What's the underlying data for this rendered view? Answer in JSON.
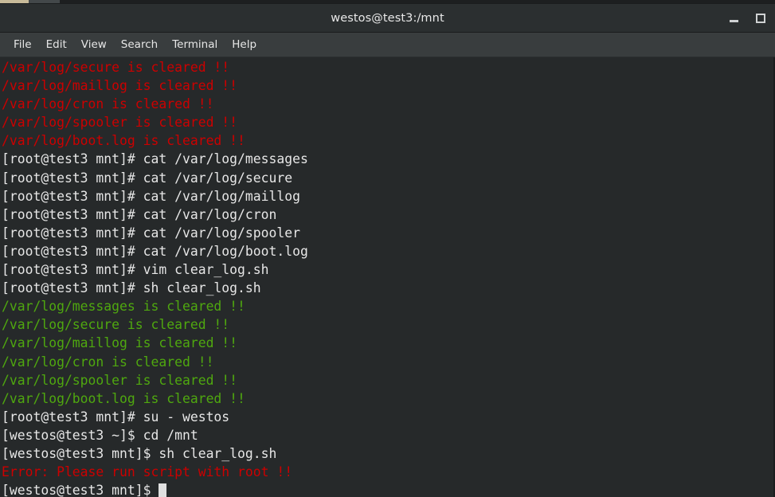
{
  "window": {
    "title": "westos@test3:/mnt",
    "controls": [
      {
        "name": "minimize",
        "label": "–"
      },
      {
        "name": "maximize",
        "label": "□"
      }
    ]
  },
  "menu": {
    "items": [
      {
        "label": "File"
      },
      {
        "label": "Edit"
      },
      {
        "label": "View"
      },
      {
        "label": "Search"
      },
      {
        "label": "Terminal"
      },
      {
        "label": "Help"
      }
    ]
  },
  "colors": {
    "titlebar_bg": "#2b2f30",
    "menubar_bg": "#393d3e",
    "terminal_bg": "#26292a",
    "text_white": "#e3e3e3",
    "text_red": "#cc0000",
    "text_green": "#4fa80f",
    "cursor": "#e0e0e0"
  },
  "terminal": {
    "prompt_root": "[root@test3 mnt]# ",
    "prompt_user_home": "[westos@test3 ~]$ ",
    "prompt_user_mnt": "[westos@test3 mnt]$ ",
    "lines": [
      {
        "color": "red",
        "text": "/var/log/secure is cleared !!"
      },
      {
        "color": "red",
        "text": "/var/log/maillog is cleared !!"
      },
      {
        "color": "red",
        "text": "/var/log/cron is cleared !!"
      },
      {
        "color": "red",
        "text": "/var/log/spooler is cleared !!"
      },
      {
        "color": "red",
        "text": "/var/log/boot.log is cleared !!"
      },
      {
        "color": "white",
        "text": "[root@test3 mnt]# cat /var/log/messages"
      },
      {
        "color": "white",
        "text": "[root@test3 mnt]# cat /var/log/secure"
      },
      {
        "color": "white",
        "text": "[root@test3 mnt]# cat /var/log/maillog"
      },
      {
        "color": "white",
        "text": "[root@test3 mnt]# cat /var/log/cron"
      },
      {
        "color": "white",
        "text": "[root@test3 mnt]# cat /var/log/spooler"
      },
      {
        "color": "white",
        "text": "[root@test3 mnt]# cat /var/log/boot.log"
      },
      {
        "color": "white",
        "text": "[root@test3 mnt]# vim clear_log.sh"
      },
      {
        "color": "white",
        "text": "[root@test3 mnt]# sh clear_log.sh"
      },
      {
        "color": "green",
        "text": "/var/log/messages is cleared !!"
      },
      {
        "color": "green",
        "text": "/var/log/secure is cleared !!"
      },
      {
        "color": "green",
        "text": "/var/log/maillog is cleared !!"
      },
      {
        "color": "green",
        "text": "/var/log/cron is cleared !!"
      },
      {
        "color": "green",
        "text": "/var/log/spooler is cleared !!"
      },
      {
        "color": "green",
        "text": "/var/log/boot.log is cleared !!"
      },
      {
        "color": "white",
        "text": "[root@test3 mnt]# su - westos"
      },
      {
        "color": "white",
        "text": "[westos@test3 ~]$ cd /mnt"
      },
      {
        "color": "white",
        "text": "[westos@test3 mnt]$ sh clear_log.sh"
      },
      {
        "color": "red",
        "text": "Error: Please run script with root !!"
      }
    ],
    "last_line": {
      "color": "white",
      "text": "[westos@test3 mnt]$ ",
      "cursor": true
    }
  }
}
